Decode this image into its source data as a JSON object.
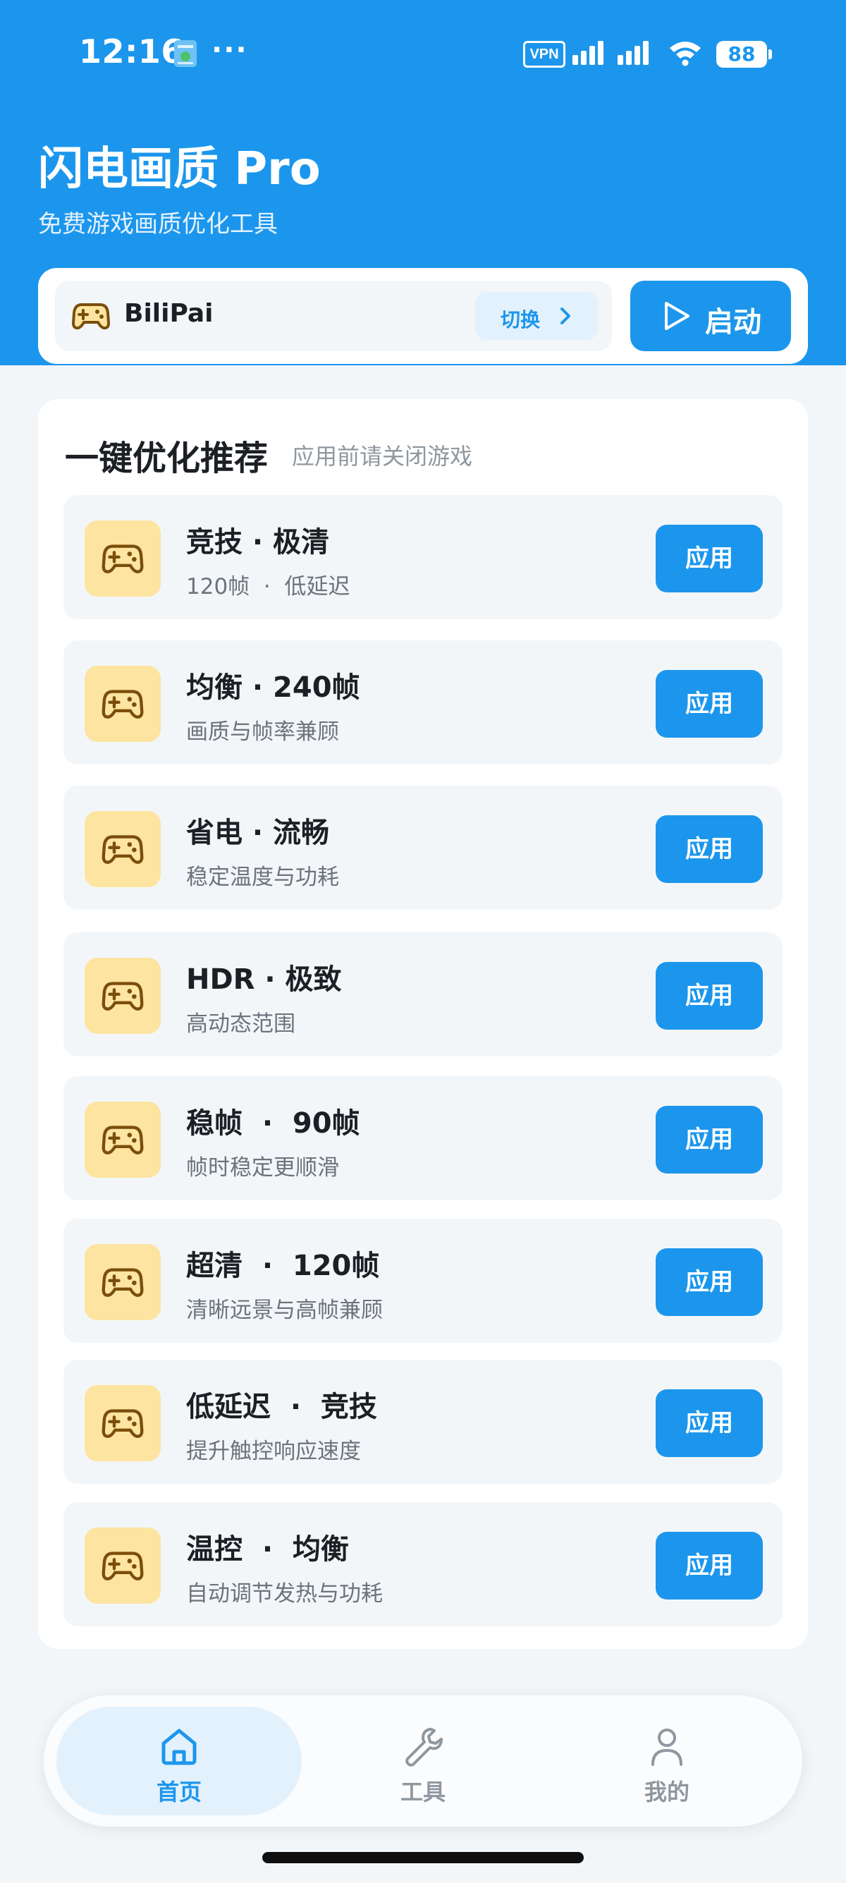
{
  "status_bar": {
    "time": "12:16",
    "dots": "···",
    "vpn": "VPN",
    "battery": "88"
  },
  "header": {
    "title": "闪电画质 Pro",
    "subtitle": "免费游戏画质优化工具"
  },
  "game_selector": {
    "game_name": "BiliPai",
    "switch_label": "切换",
    "launch_label": "启动"
  },
  "panel": {
    "title": "一键优化推荐",
    "hint": "应用前请关闭游戏",
    "presets": [
      {
        "title": "竞技 · 极清",
        "desc": "120帧  ·  低延迟",
        "button": "应用"
      },
      {
        "title": "均衡 · 240帧",
        "desc": "画质与帧率兼顾",
        "button": "应用"
      },
      {
        "title": "省电 · 流畅",
        "desc": "稳定温度与功耗",
        "button": "应用"
      },
      {
        "title": "HDR · 极致",
        "desc": "高动态范围",
        "button": "应用"
      },
      {
        "title": "稳帧  ·  90帧",
        "desc": "帧时稳定更顺滑",
        "button": "应用"
      },
      {
        "title": "超清  ·  120帧",
        "desc": "清晰远景与高帧兼顾",
        "button": "应用"
      },
      {
        "title": "低延迟  ·  竞技",
        "desc": "提升触控响应速度",
        "button": "应用"
      },
      {
        "title": "温控  ·  均衡",
        "desc": "自动调节发热与功耗",
        "button": "应用"
      }
    ]
  },
  "bottom_nav": {
    "items": [
      {
        "label": "首页",
        "icon": "home-icon",
        "active": true
      },
      {
        "label": "工具",
        "icon": "wrench-icon",
        "active": false
      },
      {
        "label": "我的",
        "icon": "person-icon",
        "active": false
      }
    ]
  },
  "colors": {
    "primary": "#1c96ec",
    "icon_bg": "#fde4a0",
    "icon_stroke": "#7a4e0a"
  }
}
